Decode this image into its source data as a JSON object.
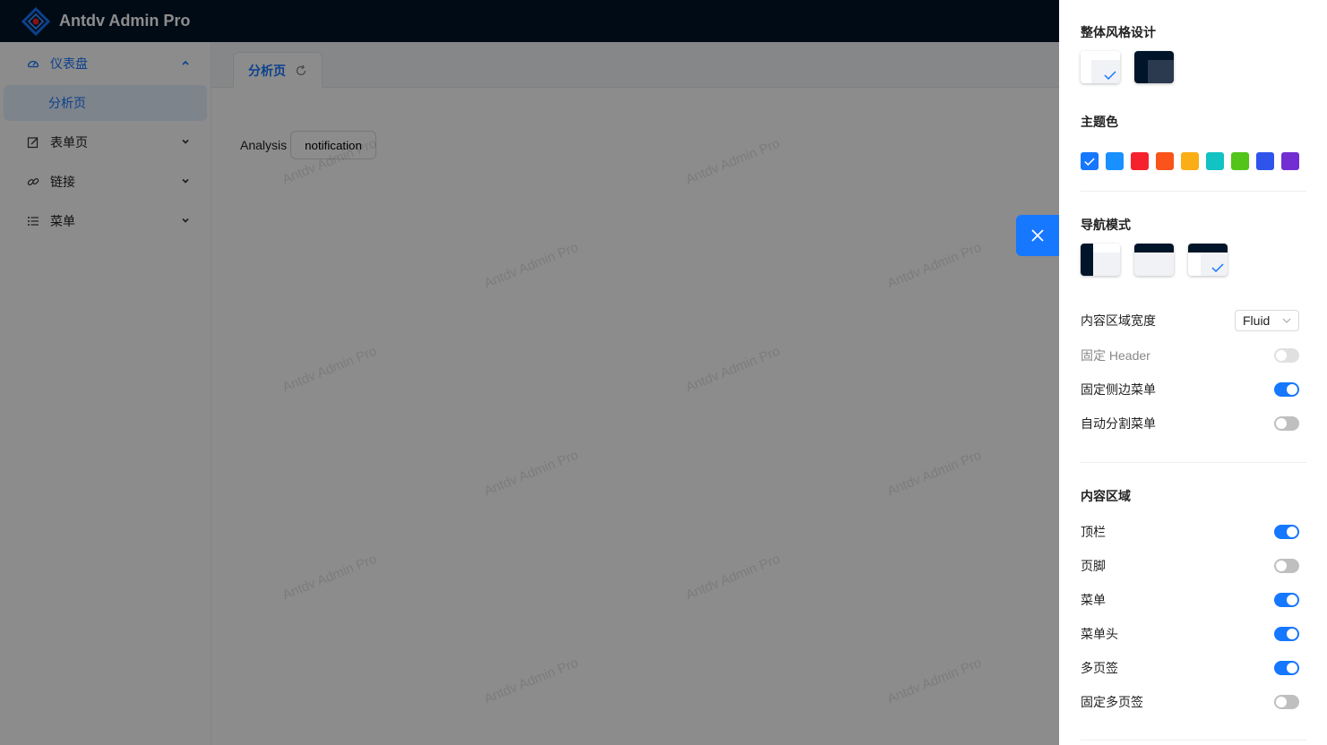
{
  "header": {
    "title": "Antdv Admin Pro"
  },
  "sidebar": {
    "items": [
      {
        "label": "仪表盘",
        "icon": "dashboard-icon"
      },
      {
        "label": "表单页",
        "icon": "form-icon"
      },
      {
        "label": "链接",
        "icon": "link-icon"
      },
      {
        "label": "菜单",
        "icon": "menu-icon"
      }
    ],
    "submenu": {
      "label": "分析页"
    }
  },
  "tabs": [
    {
      "label": "分析页",
      "icon": "reload-icon"
    }
  ],
  "content": {
    "text": "Analysis",
    "button_label": "notification",
    "watermark": "Antdv Admin Pro"
  },
  "settings": {
    "style_title": "整体风格设计",
    "theme_color_title": "主题色",
    "theme_colors": [
      "#1677ff",
      "#1890ff",
      "#f5222d",
      "#fa541c",
      "#faad14",
      "#13c2c2",
      "#52c41a",
      "#2f54eb",
      "#722ed1"
    ],
    "nav_mode_title": "导航模式",
    "content_width": {
      "label": "内容区域宽度",
      "value": "Fluid"
    },
    "fixed_header": {
      "label": "固定 Header",
      "on": false,
      "disabled": true
    },
    "fixed_sider": {
      "label": "固定侧边菜单",
      "on": true
    },
    "split_menu": {
      "label": "自动分割菜单",
      "on": false
    },
    "content_area_title": "内容区域",
    "content_area": [
      {
        "label": "顶栏",
        "on": true
      },
      {
        "label": "页脚",
        "on": false
      },
      {
        "label": "菜单",
        "on": true
      },
      {
        "label": "菜单头",
        "on": true
      },
      {
        "label": "多页签",
        "on": true
      },
      {
        "label": "固定多页签",
        "on": false
      }
    ]
  },
  "colors": {
    "primary": "#1677ff",
    "header_bg": "#001529"
  }
}
